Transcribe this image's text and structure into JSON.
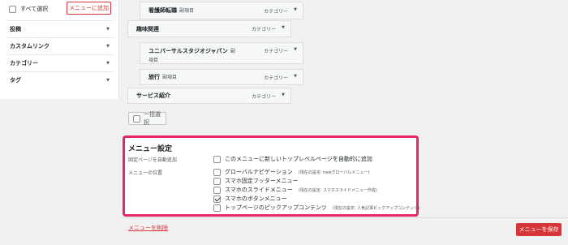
{
  "left": {
    "select_all_label": "すべて選択",
    "add_to_menu_label": "メニューに追加",
    "accordions": [
      {
        "label": "投稿"
      },
      {
        "label": "カスタムリンク"
      },
      {
        "label": "カテゴリー"
      },
      {
        "label": "タグ"
      }
    ]
  },
  "structure": {
    "items": [
      {
        "title": "看護師転職",
        "sub": "副項目",
        "type": "カテゴリー"
      },
      {
        "title": "趣味関連",
        "sub": "",
        "type": "カテゴリー"
      },
      {
        "title": "ユニバーサルスタジオジャパン",
        "sub": "副",
        "sub2": "項目",
        "type": "カテゴリー"
      },
      {
        "title": "旅行",
        "sub": "副項目",
        "type": "カテゴリー"
      },
      {
        "title": "サービス紹介",
        "sub": "",
        "type": "カテゴリー"
      }
    ],
    "bulk_select_label": "一括選択"
  },
  "settings": {
    "title": "メニュー設定",
    "auto_add_label": "固定ページを自動追加",
    "auto_add_option": "このメニューに新しいトップレベルページを自動的に追加",
    "location_label": "メニューの位置",
    "locations": [
      {
        "label": "グローバルナビゲーション",
        "note": "(現在の設定: newグローバルメニュー)",
        "checked": false
      },
      {
        "label": "スマホ固定フッターメニュー",
        "note": "",
        "checked": false
      },
      {
        "label": "スマホのスライドメニュー",
        "note": "(現在の設定: スマホスライドメニュー作成)",
        "checked": false
      },
      {
        "label": "スマホのボタンメニュー",
        "note": "",
        "checked": true
      },
      {
        "label": "トップページのピックアップコンテンツ",
        "note": "(現在の設定: 人気記事ピックアップコンテンツ)",
        "checked": false
      }
    ]
  },
  "footer": {
    "delete_label": "メニューを削除",
    "save_label": "メニューを保存"
  },
  "colors": {
    "accent_red": "#d63638",
    "highlight_pink": "#e4266a"
  },
  "icons": {
    "caret": "caret-down-icon",
    "checkbox": "checkbox-icon"
  }
}
